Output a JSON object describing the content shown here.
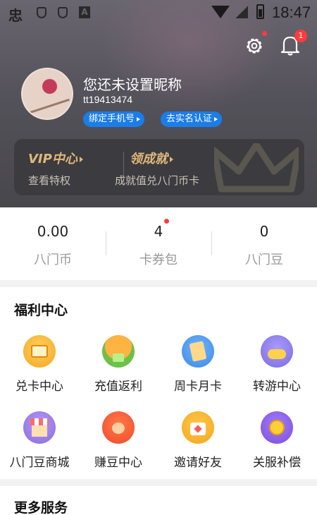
{
  "status_bar": {
    "app_glyph": "忠",
    "time": "18:47"
  },
  "header": {
    "settings_icon": "gear-icon",
    "bell_badge": "1",
    "nickname": "您还未设置昵称",
    "user_id": "tt19413474",
    "bind_phone": "绑定手机号",
    "real_name": "去实名认证"
  },
  "vip": {
    "title": "VIP中心",
    "subtitle": "查看特权",
    "achievement_title": "领成就",
    "achievement_subtitle": "成就值兑八门币卡"
  },
  "stats": [
    {
      "value": "0.00",
      "label": "八门币"
    },
    {
      "value": "4",
      "label": "卡券包",
      "dot": true
    },
    {
      "value": "0",
      "label": "八门豆"
    }
  ],
  "welfare": {
    "title": "福利中心",
    "items": [
      {
        "label": "兑卡中心",
        "icon": "card-exchange-icon",
        "color": "#f5a623"
      },
      {
        "label": "充值返利",
        "icon": "recharge-rebate-icon",
        "color": "#6dc04a"
      },
      {
        "label": "周卡月卡",
        "icon": "weekly-monthly-card-icon",
        "color": "#3b8be8"
      },
      {
        "label": "转游中心",
        "icon": "game-transfer-icon",
        "color": "#7b6be0"
      },
      {
        "label": "八门豆商城",
        "icon": "bean-mall-icon",
        "color": "#8b6bd8"
      },
      {
        "label": "赚豆中心",
        "icon": "earn-beans-icon",
        "color": "#f04a2a"
      },
      {
        "label": "邀请好友",
        "icon": "invite-friends-icon",
        "color": "#f6a51c"
      },
      {
        "label": "关服补偿",
        "icon": "server-compensation-icon",
        "color": "#7b4fd8"
      }
    ]
  },
  "more_services": {
    "title": "更多服务"
  }
}
